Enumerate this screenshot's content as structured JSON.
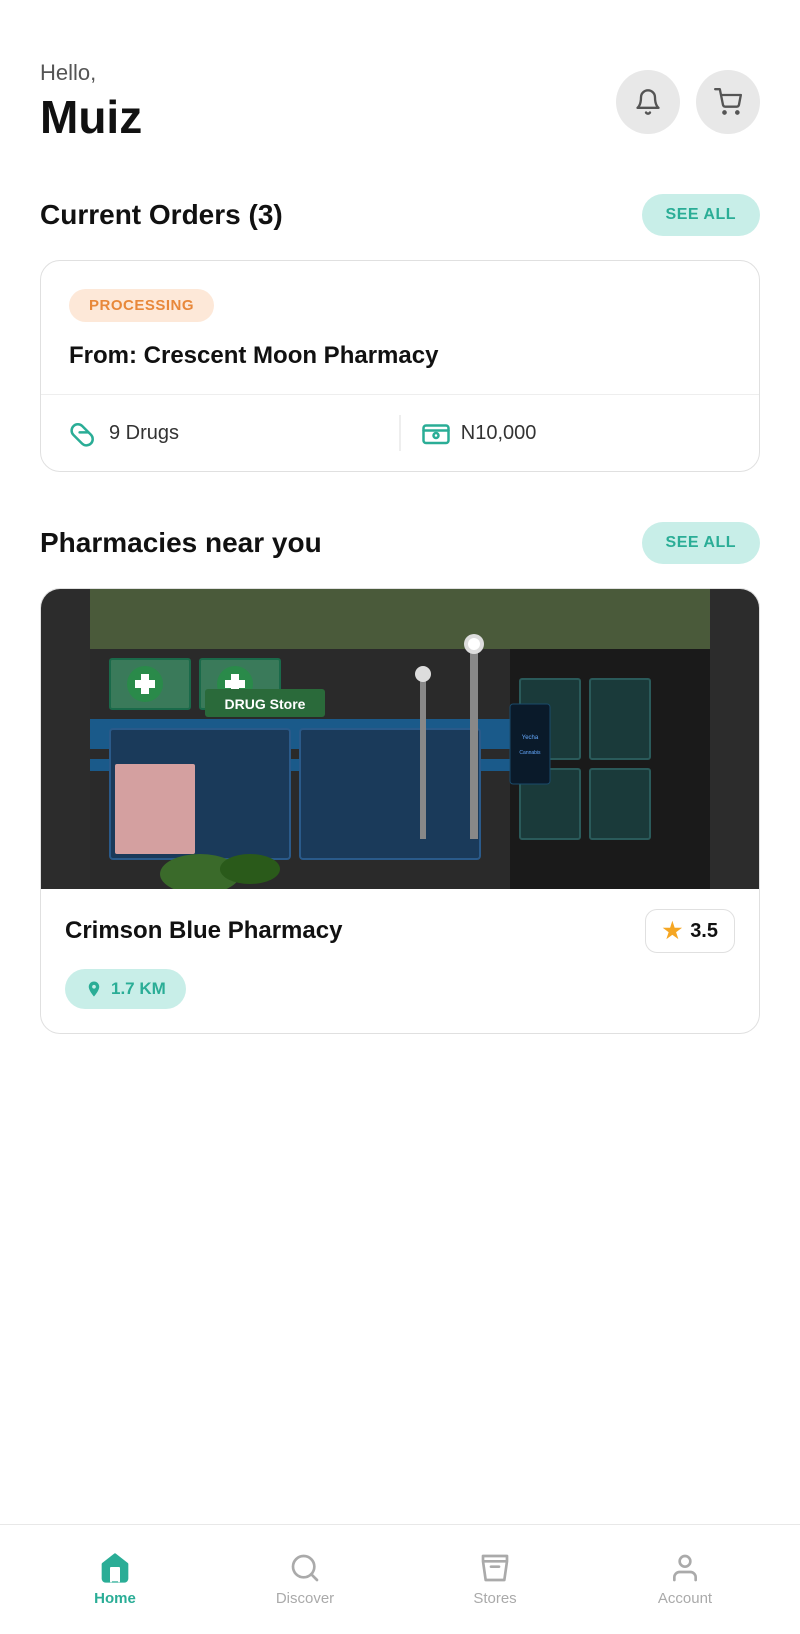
{
  "header": {
    "greeting": "Hello,",
    "username": "Muiz",
    "notification_icon": "bell-icon",
    "cart_icon": "cart-icon"
  },
  "current_orders": {
    "section_title": "Current Orders (3)",
    "see_all_label": "SEE ALL",
    "order": {
      "status": "PROCESSING",
      "from_label": "From: Crescent Moon Pharmacy",
      "drugs_icon": "pill-icon",
      "drugs_count": "9 Drugs",
      "price_icon": "money-icon",
      "price": "N10,000"
    }
  },
  "pharmacies_near_you": {
    "section_title": "Pharmacies near you",
    "see_all_label": "SEE ALL",
    "pharmacy": {
      "name": "Crimson Blue Pharmacy",
      "rating": "3.5",
      "distance": "1.7 KM"
    }
  },
  "bottom_nav": {
    "items": [
      {
        "label": "Home",
        "icon": "home-icon",
        "active": true
      },
      {
        "label": "Discover",
        "icon": "search-icon",
        "active": false
      },
      {
        "label": "Stores",
        "icon": "store-icon",
        "active": false
      },
      {
        "label": "Account",
        "icon": "account-icon",
        "active": false
      }
    ]
  }
}
